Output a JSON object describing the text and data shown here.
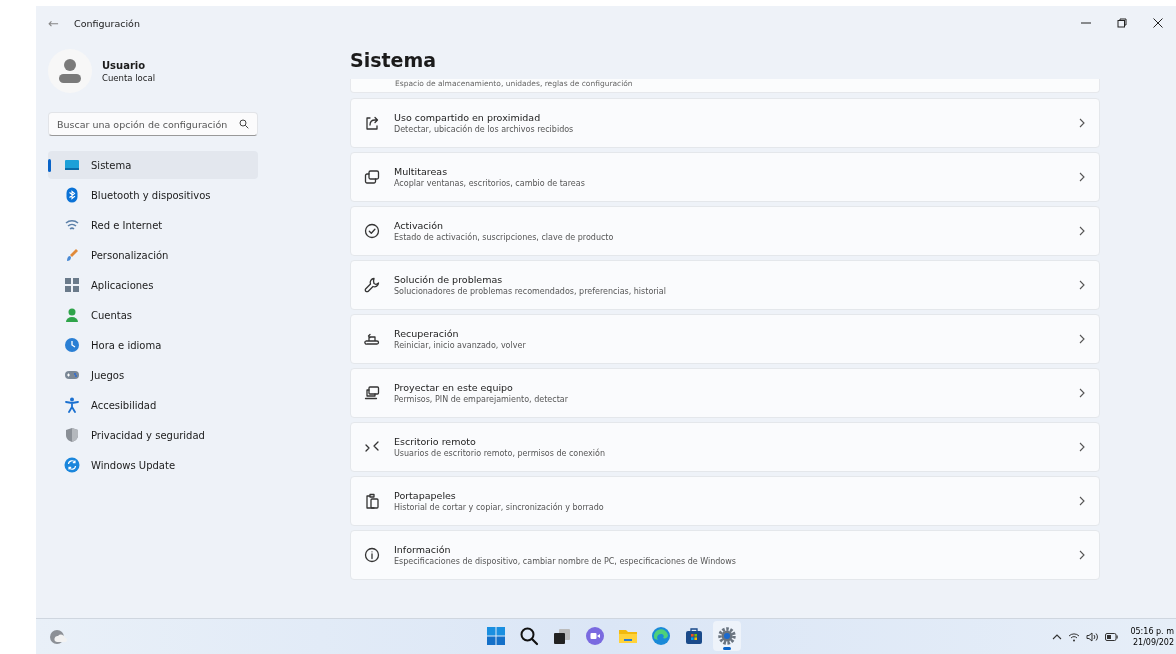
{
  "window": {
    "title": "Configuración",
    "back": "←"
  },
  "user": {
    "name": "Usuario",
    "account": "Cuenta local"
  },
  "search": {
    "placeholder": "Buscar una opción de configuración"
  },
  "sidebar": {
    "items": [
      {
        "label": "Sistema",
        "selected": true
      },
      {
        "label": "Bluetooth y dispositivos",
        "selected": false
      },
      {
        "label": "Red e Internet",
        "selected": false
      },
      {
        "label": "Personalización",
        "selected": false
      },
      {
        "label": "Aplicaciones",
        "selected": false
      },
      {
        "label": "Cuentas",
        "selected": false
      },
      {
        "label": "Hora e idioma",
        "selected": false
      },
      {
        "label": "Juegos",
        "selected": false
      },
      {
        "label": "Accesibilidad",
        "selected": false
      },
      {
        "label": "Privacidad y seguridad",
        "selected": false
      },
      {
        "label": "Windows Update",
        "selected": false
      }
    ]
  },
  "page": {
    "heading": "Sistema",
    "partial_subtitle": "Espacio de almacenamiento, unidades, reglas de configuración",
    "items": [
      {
        "title": "Uso compartido en proximidad",
        "subtitle": "Detectar, ubicación de los archivos recibidos"
      },
      {
        "title": "Multitareas",
        "subtitle": "Acoplar ventanas, escritorios, cambio de tareas"
      },
      {
        "title": "Activación",
        "subtitle": "Estado de activación, suscripciones, clave de producto"
      },
      {
        "title": "Solución de problemas",
        "subtitle": "Solucionadores de problemas recomendados, preferencias, historial"
      },
      {
        "title": "Recuperación",
        "subtitle": "Reiniciar, inicio avanzado, volver"
      },
      {
        "title": "Proyectar en este equipo",
        "subtitle": "Permisos, PIN de emparejamiento, detectar"
      },
      {
        "title": "Escritorio remoto",
        "subtitle": "Usuarios de escritorio remoto, permisos de conexión"
      },
      {
        "title": "Portapapeles",
        "subtitle": "Historial de cortar y copiar, sincronización y borrado"
      },
      {
        "title": "Información",
        "subtitle": "Especificaciones de dispositivo, cambiar nombre de PC, especificaciones de Windows"
      }
    ]
  },
  "taskbar": {
    "apps": [
      {
        "selected": false
      },
      {
        "selected": false
      },
      {
        "selected": false
      },
      {
        "selected": false
      },
      {
        "selected": false
      },
      {
        "selected": false
      },
      {
        "selected": false
      },
      {
        "selected": true
      }
    ],
    "time": "05:16 p. m",
    "date": "21/09/202"
  }
}
